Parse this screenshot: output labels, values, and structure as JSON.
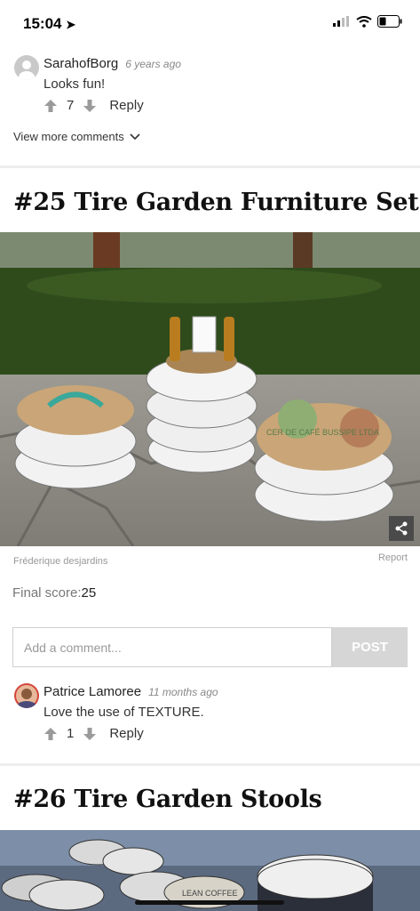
{
  "status_bar": {
    "time": "15:04"
  },
  "comment1": {
    "username": "SarahofBorg",
    "time_ago": "6 years ago",
    "text": "Looks fun!",
    "votes": "7",
    "reply": "Reply"
  },
  "view_more": "View more comments",
  "item25": {
    "title": "#25 Tire Garden Furniture Set",
    "credit": "Fréderique desjardins",
    "report": "Report",
    "score_label": "Final score:",
    "score": "25"
  },
  "comment_box": {
    "placeholder": "Add a comment...",
    "post": "POST"
  },
  "comment2": {
    "username": "Patrice Lamoree",
    "time_ago": "11 months ago",
    "text": "Love the use of TEXTURE.",
    "votes": "1",
    "reply": "Reply"
  },
  "item26": {
    "title": "#26 Tire Garden Stools"
  },
  "photo_text": {
    "left_stool": "",
    "right_stool": "CER DE CAFÉ BUSSIPE LTDA",
    "stool26": "LEAN COFFEE"
  },
  "colors": {
    "accent": "#4fb6c9",
    "heading": "#111111",
    "divider": "#eeeeee"
  }
}
